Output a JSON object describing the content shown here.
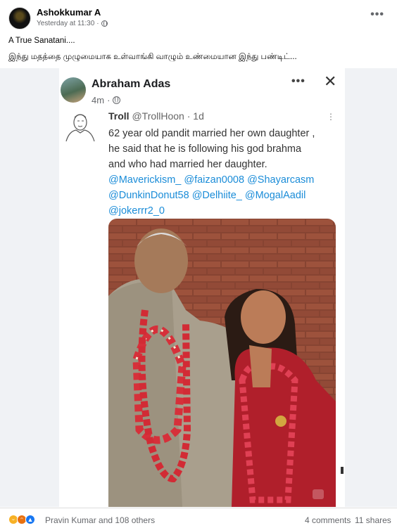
{
  "post": {
    "author": "Ashokkumar A",
    "time": "Yesterday at 11:30",
    "audience_icon": "globe-icon",
    "menu_label": "•••",
    "caption_line1": "A True Sanatani....",
    "caption_line2": "இந்து மதத்தை முழுமையாக உள்வாங்கி வாழும் உண்மையான இந்து பண்டிட்..."
  },
  "shared": {
    "author": "Abraham Adas",
    "time": "4m",
    "menu_label": "•••",
    "close_label": "✕",
    "tweet": {
      "account_name": "Troll",
      "account_handle": "@TrollHoon · 1d",
      "kebab": "⋮",
      "text_lines": [
        "62 year old pandit married her own daughter ,",
        "he said that he is following his god brahma",
        "and who had married her daughter."
      ],
      "mention_lines": [
        "@Maverickism_ @faizan0008 @Shayarcasm",
        "@DunkinDonut58 @Delhiite_ @MogalAadil",
        "@jokerrr2_0"
      ]
    }
  },
  "footer": {
    "reaction_icons": [
      "haha-icon",
      "angry-icon",
      "like-icon"
    ],
    "reactions_text": "Pravin Kumar and 108 others",
    "comments": "4 comments",
    "shares": "11 shares"
  },
  "colors": {
    "link": "#1a8cd8",
    "secondary": "#65676b",
    "like": "#1877f2",
    "haha": "#f7b125",
    "angry": "#e9710f"
  }
}
